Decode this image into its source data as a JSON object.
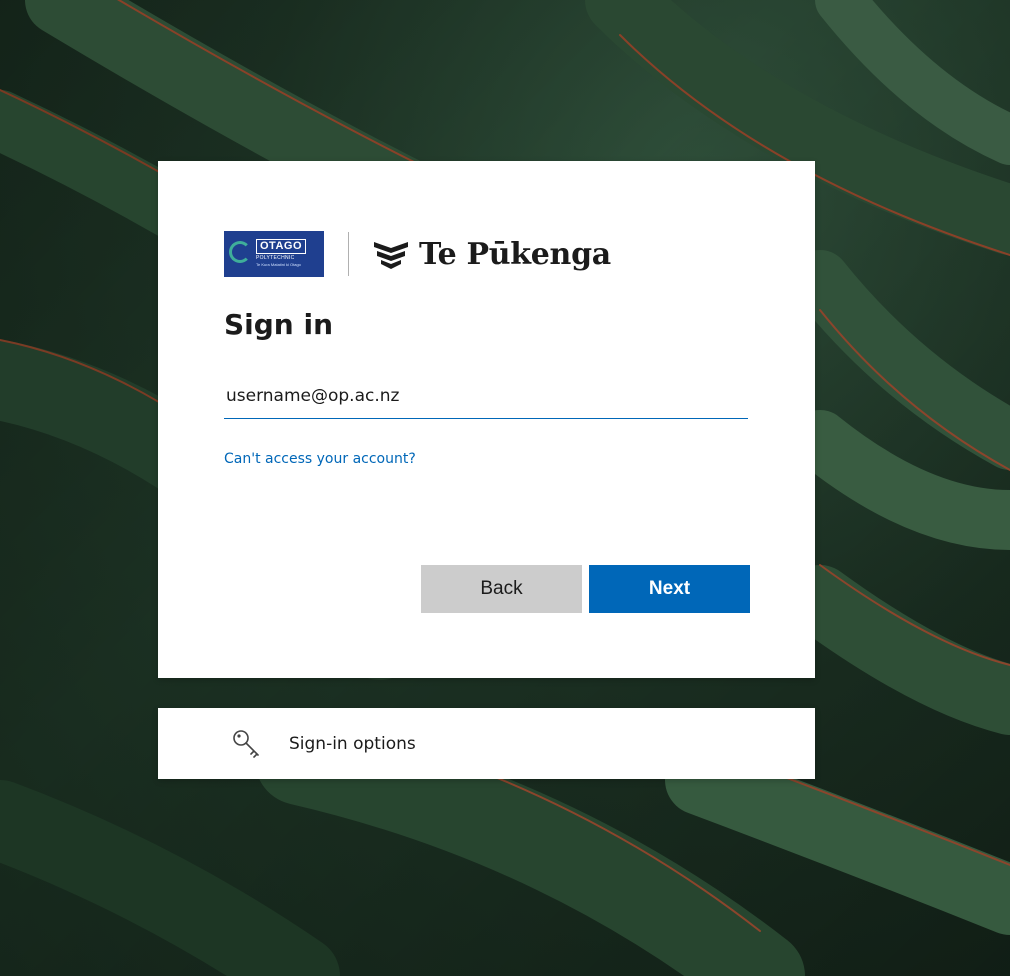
{
  "logos": {
    "otago_name": "OTAGO",
    "otago_sub": "POLYTECHNIC",
    "otago_tag": "Te Kura Matatini ki Otago",
    "partner_name": "Te Pūkenga"
  },
  "signin": {
    "title": "Sign in",
    "username_value": "username@op.ac.nz",
    "cant_access_link": "Can't access your account?",
    "back_label": "Back",
    "next_label": "Next"
  },
  "options": {
    "label": "Sign-in options",
    "icon": "key-icon"
  },
  "colors": {
    "accent": "#0067b8",
    "back_button": "#cccccc",
    "otago_brand": "#1f3f8f"
  }
}
